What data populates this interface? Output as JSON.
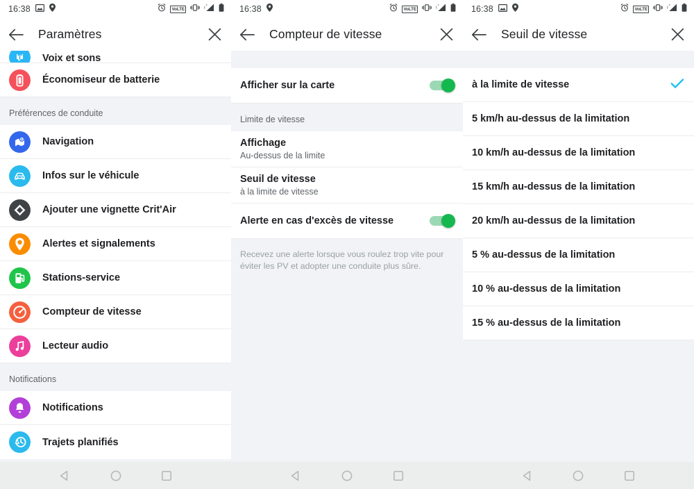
{
  "meta": {
    "accent_green": "#15b84e",
    "accent_cyan": "#1ec0f3",
    "bg_gray": "#f1f3f6",
    "text_primary": "#202124",
    "text_secondary": "#5f6368"
  },
  "status_bar": {
    "time": "16:38",
    "volte_label": "VoLTE",
    "left_icons": [
      "image-icon",
      "location-pin-icon"
    ],
    "right_icons": [
      "alarm-icon",
      "volte-icon",
      "vibrate-icon",
      "signal-icon",
      "battery-icon"
    ]
  },
  "navbar": {
    "back_label": "Back",
    "home_label": "Home",
    "recents_label": "Recents"
  },
  "panels": [
    {
      "id": "settings",
      "title": "Paramètres",
      "back_icon": "arrow-back-icon",
      "close_icon": "close-icon",
      "status_left_icons": [
        "image-icon",
        "location-pin-icon"
      ],
      "sections": [
        {
          "header": null,
          "items": [
            {
              "label": "Voix et sons",
              "icon": "voice-sounds-icon",
              "icon_color": "#29b6f6",
              "clipped": true
            },
            {
              "label": "Économiseur de batterie",
              "icon": "battery-saver-icon",
              "icon_color": "#f4515b"
            }
          ]
        },
        {
          "header": "Préférences de conduite",
          "items": [
            {
              "label": "Navigation",
              "icon": "navigation-map-icon",
              "icon_color": "#3367ec"
            },
            {
              "label": "Infos sur le véhicule",
              "icon": "car-info-icon",
              "icon_color": "#2bbaed"
            },
            {
              "label": "Ajouter une vignette Crit'Air",
              "icon": "critair-sticker-icon",
              "icon_color": "#3f4346"
            },
            {
              "label": "Alertes et signalements",
              "icon": "alerts-reports-icon",
              "icon_color": "#fb8c00"
            },
            {
              "label": "Stations-service",
              "icon": "fuel-station-icon",
              "icon_color": "#1fc54a"
            },
            {
              "label": "Compteur de vitesse",
              "icon": "speedometer-icon",
              "icon_color": "#f4603e"
            },
            {
              "label": "Lecteur audio",
              "icon": "audio-player-icon",
              "icon_color": "#ec3f9c"
            }
          ]
        },
        {
          "header": "Notifications",
          "items": [
            {
              "label": "Notifications",
              "icon": "bell-icon",
              "icon_color": "#b23fd8"
            },
            {
              "label": "Trajets planifiés",
              "icon": "planned-trips-icon",
              "icon_color": "#2bbaed",
              "partial": true
            }
          ]
        }
      ]
    },
    {
      "id": "speedometer",
      "title": "Compteur de vitesse",
      "back_icon": "arrow-back-icon",
      "close_icon": "close-icon",
      "status_left_icons": [
        "location-pin-icon"
      ],
      "rows": [
        {
          "type": "toggle",
          "label": "Afficher sur la carte",
          "value": "on"
        }
      ],
      "section_header": "Limite de vitesse",
      "sub_rows": [
        {
          "type": "two-line",
          "title": "Affichage",
          "subtitle": "Au-dessus de la limite"
        },
        {
          "type": "two-line",
          "title": "Seuil de vitesse",
          "subtitle": "à la limite de vitesse"
        },
        {
          "type": "toggle",
          "label": "Alerte en cas d'excès de vitesse",
          "value": "on"
        }
      ],
      "hint": "Recevez une alerte lorsque vous roulez trop vite pour éviter les PV et adopter une conduite plus sûre."
    },
    {
      "id": "speed-threshold",
      "title": "Seuil de vitesse",
      "back_icon": "arrow-back-icon",
      "close_icon": "close-icon",
      "status_left_icons": [
        "image-icon",
        "location-pin-icon"
      ],
      "options": [
        {
          "label": "à la limite de vitesse",
          "selected": true
        },
        {
          "label": "5 km/h au-dessus de la limitation",
          "selected": false
        },
        {
          "label": "10 km/h au-dessus de la limitation",
          "selected": false
        },
        {
          "label": "15 km/h au-dessus de la limitation",
          "selected": false
        },
        {
          "label": "20 km/h au-dessus de la limitation",
          "selected": false
        },
        {
          "label": "5 % au-dessus de la limitation",
          "selected": false
        },
        {
          "label": "10 % au-dessus de la limitation",
          "selected": false
        },
        {
          "label": "15 % au-dessus de la limitation",
          "selected": false
        }
      ]
    }
  ]
}
